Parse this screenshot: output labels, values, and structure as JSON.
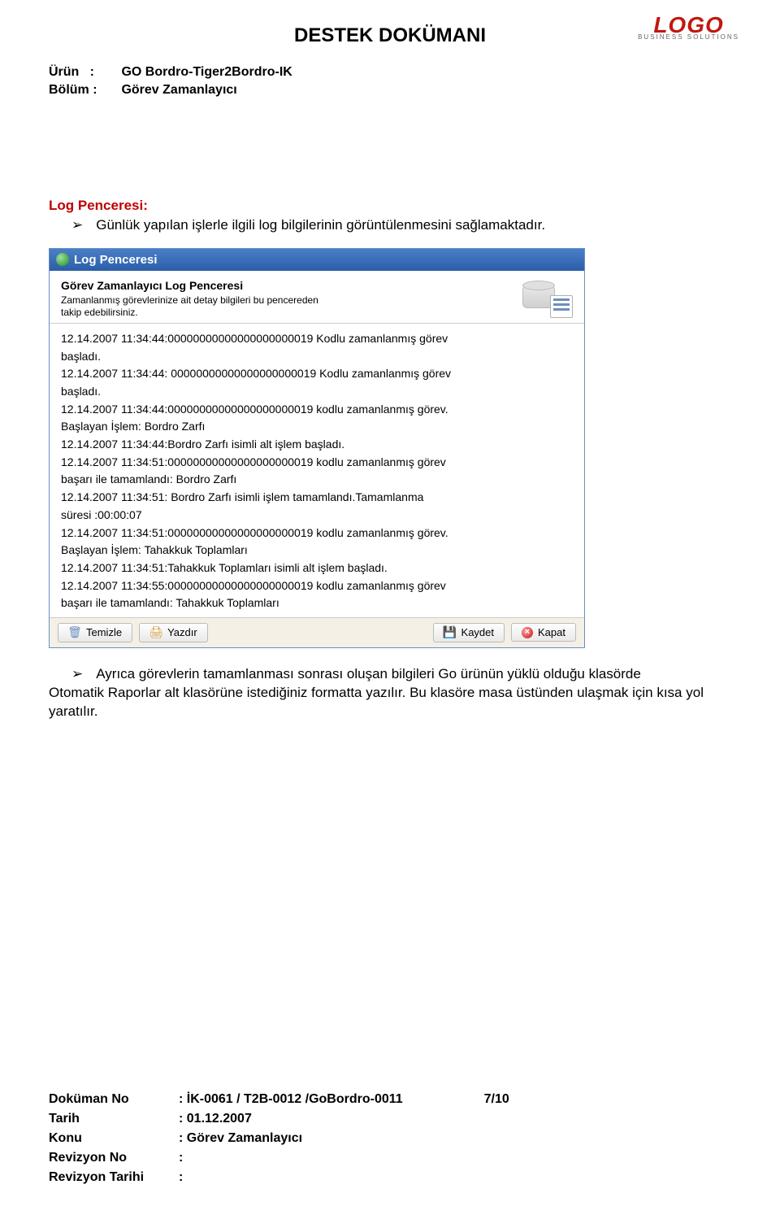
{
  "logo": {
    "text": "LOGO",
    "sub": "BUSINESS SOLUTIONS"
  },
  "doc": {
    "title": "DESTEK DOKÜMANI",
    "meta": {
      "urun_label": "Ürün",
      "urun_value": "GO Bordro-Tiger2Bordro-IK",
      "bolum_label": "Bölüm",
      "bolum_value": "Görev Zamanlayıcı"
    },
    "section_title": "Log Penceresi:",
    "bullet1": "Günlük yapılan işlerle ilgili log bilgilerinin görüntülenmesini sağlamaktadır.",
    "bullet2_a": "Ayrıca görevlerin tamamlanması sonrası  oluşan bilgileri  Go ürünün yüklü olduğu klasörde",
    "bullet2_b": "Otomatik Raporlar alt klasörüne istediğiniz formatta yazılır. Bu klasöre masa üstünden ulaşmak için kısa yol yaratılır."
  },
  "window": {
    "title": "Log Penceresi",
    "subtitle": "Görev Zamanlayıcı Log Penceresi",
    "desc1": "Zamanlanmış görevlerinize ait  detay bilgileri bu pencereden",
    "desc2": " takip edebilirsiniz.",
    "logs": [
      "12.14.2007 11:34:44:00000000000000000000019 Kodlu zamanlanmış görev",
      "başladı.",
      "12.14.2007 11:34:44: 00000000000000000000019 Kodlu zamanlanmış görev",
      "başladı.",
      "12.14.2007 11:34:44:00000000000000000000019 kodlu zamanlanmış görev.",
      "Başlayan İşlem: Bordro Zarfı",
      "12.14.2007 11:34:44:Bordro Zarfı isimli alt işlem başladı.",
      "12.14.2007 11:34:51:00000000000000000000019 kodlu zamanlanmış görev",
      "başarı ile tamamlandı: Bordro Zarfı",
      "12.14.2007 11:34:51: Bordro Zarfı isimli işlem tamamlandı.Tamamlanma",
      "süresi :00:00:07",
      "12.14.2007 11:34:51:00000000000000000000019 kodlu zamanlanmış görev.",
      "Başlayan İşlem: Tahakkuk Toplamları",
      "12.14.2007 11:34:51:Tahakkuk Toplamları isimli alt işlem başladı.",
      "12.14.2007 11:34:55:00000000000000000000019 kodlu zamanlanmış görev",
      "başarı ile tamamlandı: Tahakkuk Toplamları"
    ],
    "buttons": {
      "clear": "Temizle",
      "print": "Yazdır",
      "save": "Kaydet",
      "close": "Kapat"
    }
  },
  "footer": {
    "dokuman_no_label": "Doküman No",
    "dokuman_no_value": ": İK-0061 / T2B-0012 /GoBordro-0011",
    "page_num": "7/10",
    "tarih_label": "Tarih",
    "tarih_value": ": 01.12.2007",
    "konu_label": "Konu",
    "konu_value": ": Görev Zamanlayıcı",
    "revno_label": "Revizyon No",
    "revno_value": ":",
    "revtar_label": "Revizyon Tarihi",
    "revtar_value": ":"
  }
}
